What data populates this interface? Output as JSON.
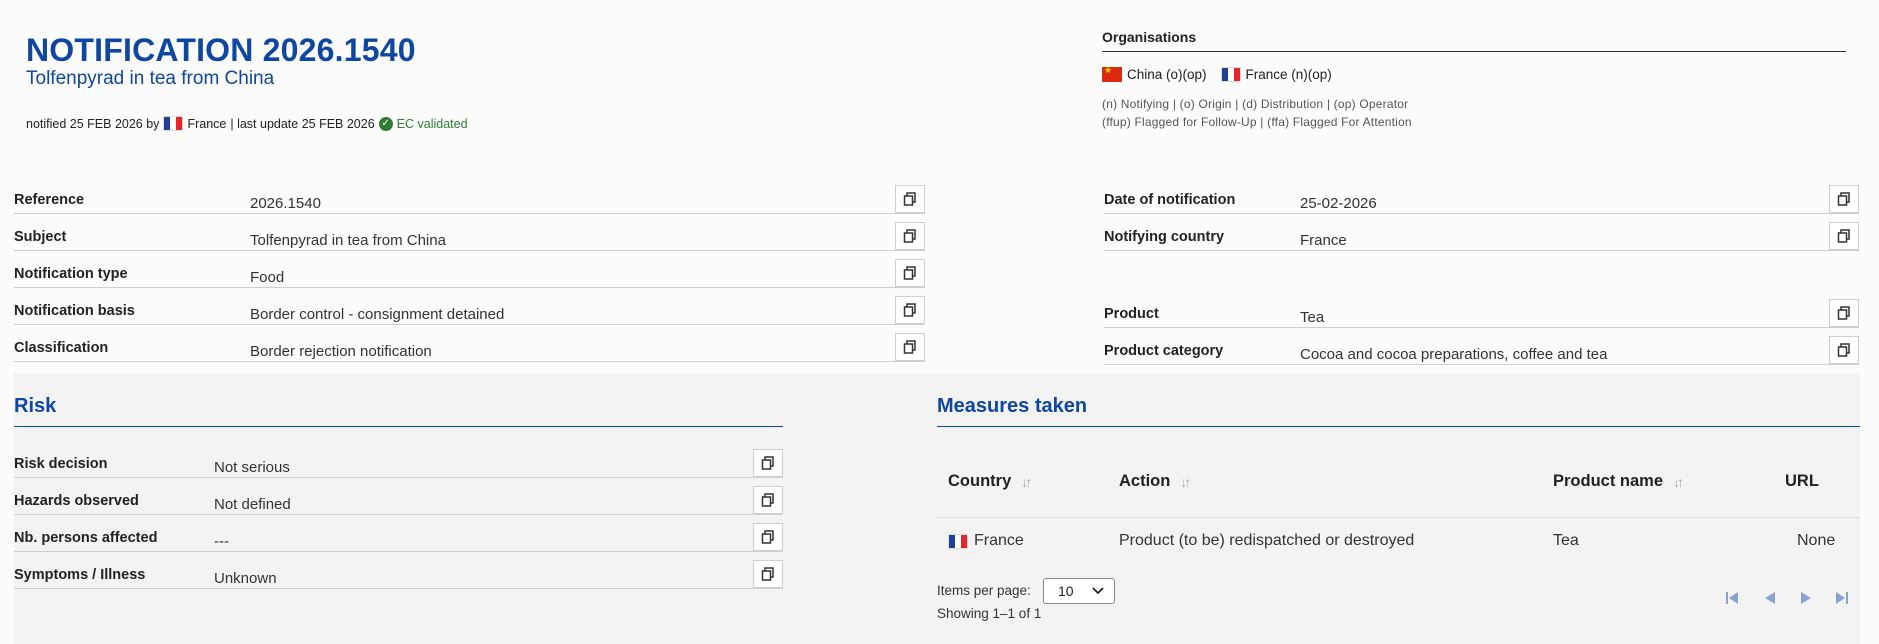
{
  "header": {
    "title": "NOTIFICATION 2026.1540",
    "subtitle": "Tolfenpyrad in tea from China",
    "notified_prefix": "notified 25 FEB 2026 by",
    "notified_country": "France",
    "last_update": "| last update 25 FEB 2026",
    "validation": "EC validated"
  },
  "organisations": {
    "title": "Organisations",
    "items": [
      {
        "flag": "china-flag",
        "label": "China (o)(op)"
      },
      {
        "flag": "france-flag",
        "label": "France (n)(op)"
      }
    ],
    "legend_line1": "(n) Notifying | (o) Origin | (d) Distribution | (op) Operator",
    "legend_line2": "(ffup) Flagged for Follow-Up | (ffa) Flagged For Attention"
  },
  "details_left": [
    {
      "label": "Reference",
      "value": "2026.1540"
    },
    {
      "label": "Subject",
      "value": "Tolfenpyrad in tea from China"
    },
    {
      "label": "Notification type",
      "value": "Food"
    },
    {
      "label": "Notification basis",
      "value": "Border control - consignment detained"
    },
    {
      "label": "Classification",
      "value": "Border rejection notification"
    }
  ],
  "details_right": [
    {
      "label": "Date of notification",
      "value": "25-02-2026"
    },
    {
      "label": "Notifying country",
      "value": "France"
    },
    {
      "label": "Product",
      "value": "Tea"
    },
    {
      "label": "Product category",
      "value": "Cocoa and cocoa preparations, coffee and tea"
    }
  ],
  "risk": {
    "title": "Risk",
    "rows": [
      {
        "label": "Risk decision",
        "value": "Not serious"
      },
      {
        "label": "Hazards observed",
        "value": "Not defined"
      },
      {
        "label": "Nb. persons affected",
        "value": "---"
      },
      {
        "label": "Symptoms / Illness",
        "value": "Unknown"
      }
    ]
  },
  "measures": {
    "title": "Measures taken",
    "columns": [
      "Country",
      "Action",
      "Product name",
      "URL"
    ],
    "rows": [
      {
        "country": "France",
        "action": "Product (to be) redispatched or destroyed",
        "product": "Tea",
        "url": "None"
      }
    ],
    "items_per_page_label": "Items per page:",
    "items_per_page_value": "10",
    "showing": "Showing 1–1 of 1"
  },
  "colors": {
    "accent": "#0e47a1",
    "success": "#2e7d32",
    "pager": "#8aa3d6"
  }
}
